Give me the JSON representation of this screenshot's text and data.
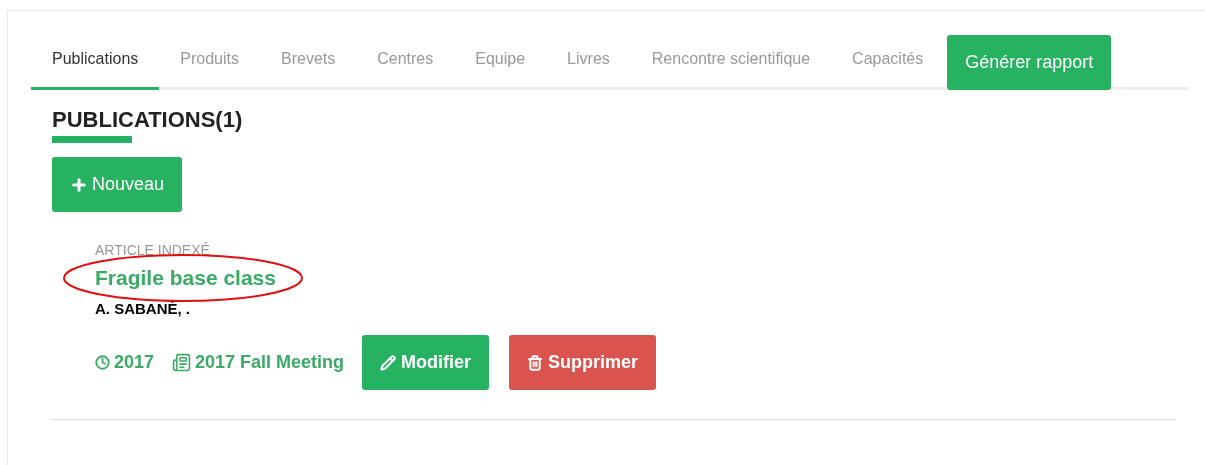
{
  "tabs": [
    {
      "label": "Publications",
      "selected": true
    },
    {
      "label": "Produits",
      "selected": false
    },
    {
      "label": "Brevets",
      "selected": false
    },
    {
      "label": "Centres",
      "selected": false
    },
    {
      "label": "Equipe",
      "selected": false
    },
    {
      "label": "Livres",
      "selected": false
    },
    {
      "label": "Rencontre scientifique",
      "selected": false
    },
    {
      "label": "Capacités",
      "selected": false
    }
  ],
  "report_button": "Générer rapport",
  "heading": "PUBLICATIONS(1)",
  "new_button": "Nouveau",
  "publications": [
    {
      "type": "ARTICLE INDEXÉ",
      "title": "Fragile base class",
      "circled": true,
      "authors": "A. SABANÉ, .",
      "year": "2017",
      "venue": "2017 Fall Meeting",
      "edit_button": "Modifier",
      "delete_button": "Supprimer"
    }
  ]
}
